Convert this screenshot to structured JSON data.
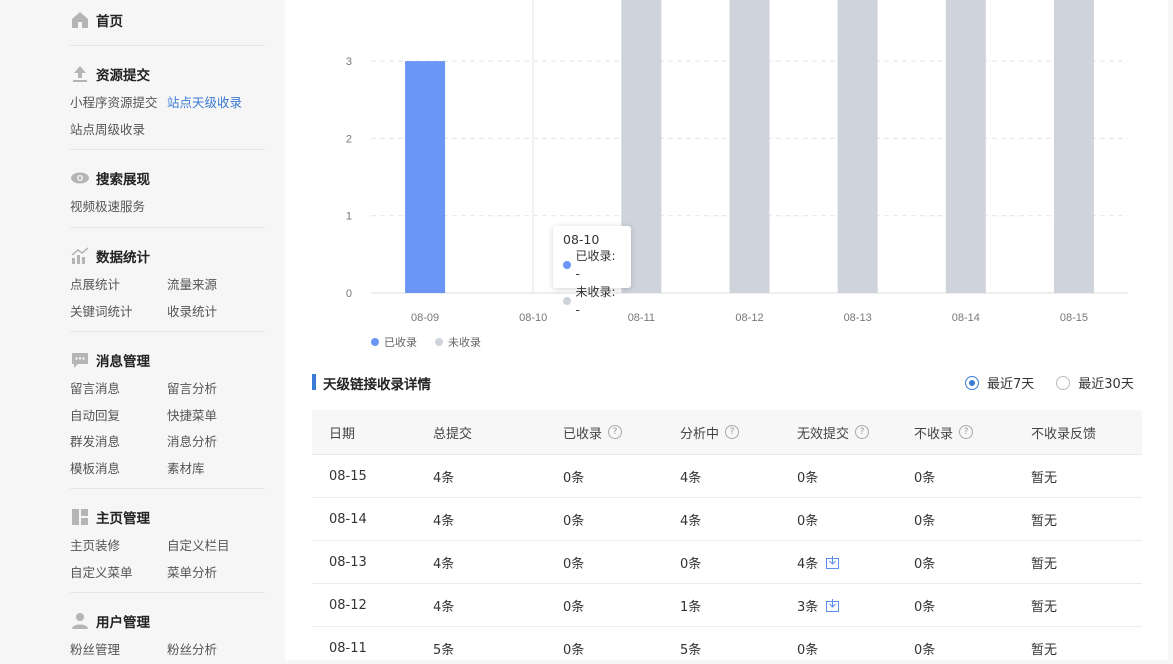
{
  "sidebar": {
    "home": "首页",
    "sections": [
      {
        "title": "资源提交",
        "icon": "upload-icon",
        "items": [
          {
            "label": "小程序资源提交",
            "active": false
          },
          {
            "label": "站点天级收录",
            "active": true
          },
          {
            "label": "站点周级收录",
            "active": false
          }
        ]
      },
      {
        "title": "搜索展现",
        "icon": "eye-icon",
        "items": [
          {
            "label": "视频极速服务",
            "active": false
          }
        ]
      },
      {
        "title": "数据统计",
        "icon": "stats-icon",
        "items": [
          {
            "label": "点展统计"
          },
          {
            "label": "流量来源"
          },
          {
            "label": "关键词统计"
          },
          {
            "label": "收录统计"
          }
        ]
      },
      {
        "title": "消息管理",
        "icon": "message-icon",
        "items": [
          {
            "label": "留言消息"
          },
          {
            "label": "留言分析"
          },
          {
            "label": "自动回复"
          },
          {
            "label": "快捷菜单"
          },
          {
            "label": "群发消息"
          },
          {
            "label": "消息分析"
          },
          {
            "label": "模板消息"
          },
          {
            "label": "素材库"
          }
        ]
      },
      {
        "title": "主页管理",
        "icon": "layout-icon",
        "items": [
          {
            "label": "主页装修"
          },
          {
            "label": "自定义栏目"
          },
          {
            "label": "自定义菜单"
          },
          {
            "label": "菜单分析"
          }
        ]
      },
      {
        "title": "用户管理",
        "icon": "user-icon",
        "items": [
          {
            "label": "粉丝管理"
          },
          {
            "label": "粉丝分析"
          }
        ]
      }
    ]
  },
  "chart_data": {
    "type": "bar",
    "categories": [
      "08-09",
      "08-10",
      "08-11",
      "08-12",
      "08-13",
      "08-14",
      "08-15"
    ],
    "series": [
      {
        "name": "已收录",
        "values": [
          3,
          0,
          0,
          0,
          0,
          0,
          0
        ],
        "color": "#6b96f7"
      },
      {
        "name": "未收录",
        "values": [
          0,
          0,
          5,
          4,
          4,
          4,
          4
        ],
        "color": "#cfd3dc"
      }
    ],
    "y_ticks": [
      "0",
      "1",
      "2",
      "3"
    ],
    "ylim": [
      0,
      3.8
    ],
    "grid": true,
    "legend": "bottom-left"
  },
  "tooltip": {
    "date": "08-10",
    "rows": [
      {
        "label": "已收录: -",
        "color": "#6b96f7"
      },
      {
        "label": "未收录: -",
        "color": "#cfd3dc"
      }
    ]
  },
  "section": {
    "title": "天级链接收录详情"
  },
  "range": {
    "options": [
      {
        "label": "最近7天",
        "checked": true
      },
      {
        "label": "最近30天",
        "checked": false
      }
    ]
  },
  "table": {
    "headers": [
      {
        "label": "日期",
        "help": false
      },
      {
        "label": "总提交",
        "help": false
      },
      {
        "label": "已收录",
        "help": true
      },
      {
        "label": "分析中",
        "help": true
      },
      {
        "label": "无效提交",
        "help": true
      },
      {
        "label": "不收录",
        "help": true
      },
      {
        "label": "不收录反馈",
        "help": false
      }
    ],
    "help_glyph": "?",
    "rows": [
      {
        "date": "08-15",
        "total": "4条",
        "indexed": "0条",
        "analyzing": "4条",
        "invalid": "0条",
        "invalid_dl": false,
        "not_indexed": "0条",
        "feedback": "暂无"
      },
      {
        "date": "08-14",
        "total": "4条",
        "indexed": "0条",
        "analyzing": "4条",
        "invalid": "0条",
        "invalid_dl": false,
        "not_indexed": "0条",
        "feedback": "暂无"
      },
      {
        "date": "08-13",
        "total": "4条",
        "indexed": "0条",
        "analyzing": "0条",
        "invalid": "4条",
        "invalid_dl": true,
        "not_indexed": "0条",
        "feedback": "暂无"
      },
      {
        "date": "08-12",
        "total": "4条",
        "indexed": "0条",
        "analyzing": "1条",
        "invalid": "3条",
        "invalid_dl": true,
        "not_indexed": "0条",
        "feedback": "暂无"
      },
      {
        "date": "08-11",
        "total": "5条",
        "indexed": "0条",
        "analyzing": "5条",
        "invalid": "0条",
        "invalid_dl": false,
        "not_indexed": "0条",
        "feedback": "暂无"
      }
    ]
  }
}
